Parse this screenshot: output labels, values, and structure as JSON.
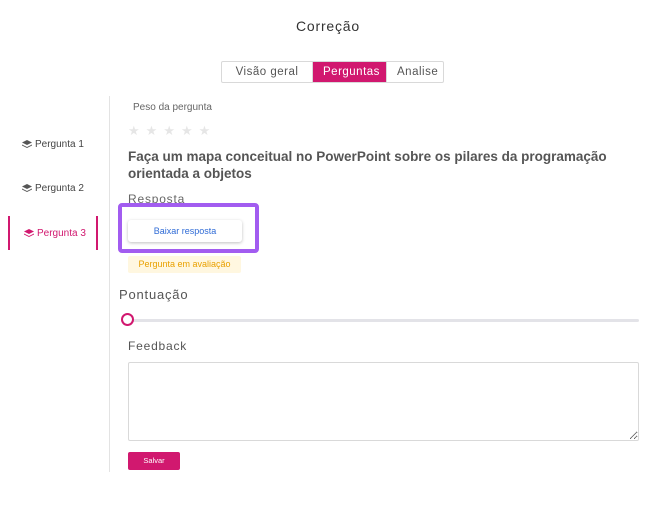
{
  "header": {
    "title": "Correção"
  },
  "tabs": [
    {
      "label": "Visão geral",
      "active": false
    },
    {
      "label": "Perguntas",
      "active": true
    },
    {
      "label": "Analise",
      "active": false
    }
  ],
  "sidebar": {
    "items": [
      {
        "label": "Pergunta 1",
        "icon": "layers-icon",
        "active": false
      },
      {
        "label": "Pergunta  2",
        "icon": "layers-icon",
        "active": false
      },
      {
        "label": "Pergunta  3",
        "icon": "layers-icon",
        "active": true
      }
    ]
  },
  "question": {
    "weight_label": "Peso da pergunta",
    "weight_stars": 0,
    "weight_max": 5,
    "text": "Faça um mapa conceitual no PowerPoint sobre os pilares da programação orientada a objetos",
    "answer_label": "Resposta",
    "download_label": "Baixar resposta",
    "status": "Pergunta em avaliação"
  },
  "score": {
    "label": "Pontuação",
    "value": 0
  },
  "feedback": {
    "label": "Feedback",
    "value": "",
    "placeholder": ""
  },
  "actions": {
    "save_label": "Salvar"
  },
  "colors": {
    "accent": "#d1186f",
    "highlight": "#a25cf0",
    "link": "#2f6bd6",
    "status_text": "#e9a100",
    "status_bg": "#fff7e0"
  }
}
